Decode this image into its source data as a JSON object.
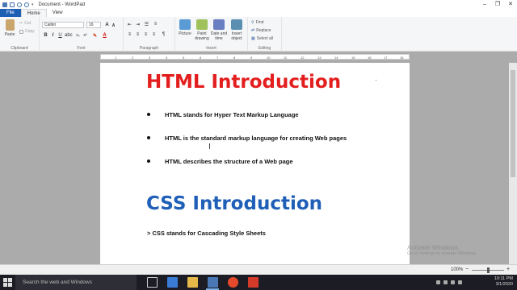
{
  "window": {
    "title": "Document - WordPad"
  },
  "tabs": [
    {
      "label": "File"
    },
    {
      "label": "Home"
    },
    {
      "label": "View"
    }
  ],
  "ribbon": {
    "clipboard": {
      "paste": "Paste",
      "cut": "Cut",
      "copy": "Copy",
      "label": "Clipboard"
    },
    "font": {
      "family": "Calibri",
      "size": "16",
      "label": "Font"
    },
    "paragraph": {
      "label": "Paragraph"
    },
    "insert": {
      "label": "Insert",
      "picture": "Picture",
      "paint": "Paint drawing",
      "datetime": "Date and time",
      "object": "Insert object"
    },
    "editing": {
      "label": "Editing",
      "find": "Find",
      "replace": "Replace",
      "select_all": "Select all"
    }
  },
  "ruler": {
    "ticks": [
      "1",
      "2",
      "3",
      "4",
      "5",
      "6",
      "7",
      "8",
      "9",
      "10",
      "11",
      "12",
      "13",
      "14",
      "15",
      "16",
      "17",
      "18"
    ]
  },
  "document": {
    "heading1": "HTML Introduction",
    "bullets": [
      "HTML stands for Hyper Text Markup Language",
      "HTML is the standard markup language for creating Web pages",
      "HTML describes the structure of a Web page"
    ],
    "heading2": "CSS Introduction",
    "css_line": "> CSS stands for Cascading Style Sheets"
  },
  "statusbar": {
    "zoom": "100%",
    "zoom_level": 0.5
  },
  "watermark": {
    "title": "Activate Windows",
    "sub": "Go to Settings to activate Windows."
  },
  "taskbar": {
    "search_placeholder": "Search the web and Windows",
    "time": "10:11 PM",
    "date": "3/1/2020"
  },
  "colors": {
    "heading1": "#e31e1e",
    "heading2": "#1f5fb7",
    "file_tab": "#1e5fb4",
    "taskbar": "#1c1c24"
  }
}
